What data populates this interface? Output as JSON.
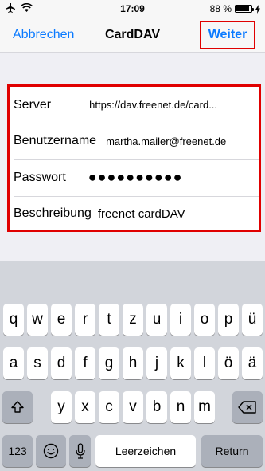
{
  "status": {
    "time": "17:09",
    "battery": "88 %",
    "battery_level": 0.88
  },
  "nav": {
    "cancel": "Abbrechen",
    "title": "CardDAV",
    "next": "Weiter"
  },
  "form": {
    "server": {
      "label": "Server",
      "value": "https://dav.freenet.de/card..."
    },
    "user": {
      "label": "Benutzername",
      "value": "martha.mailer@freenet.de"
    },
    "password": {
      "label": "Passwort",
      "value": "●●●●●●●●●●"
    },
    "description": {
      "label": "Beschreibung",
      "value": "freenet cardDAV"
    }
  },
  "keyboard": {
    "row1": [
      "q",
      "w",
      "e",
      "r",
      "t",
      "z",
      "u",
      "i",
      "o",
      "p",
      "ü"
    ],
    "row2": [
      "a",
      "s",
      "d",
      "f",
      "g",
      "h",
      "j",
      "k",
      "l",
      "ö",
      "ä"
    ],
    "row3": [
      "y",
      "x",
      "c",
      "v",
      "b",
      "n",
      "m"
    ],
    "numbers": "123",
    "space": "Leerzeichen",
    "return": "Return"
  }
}
